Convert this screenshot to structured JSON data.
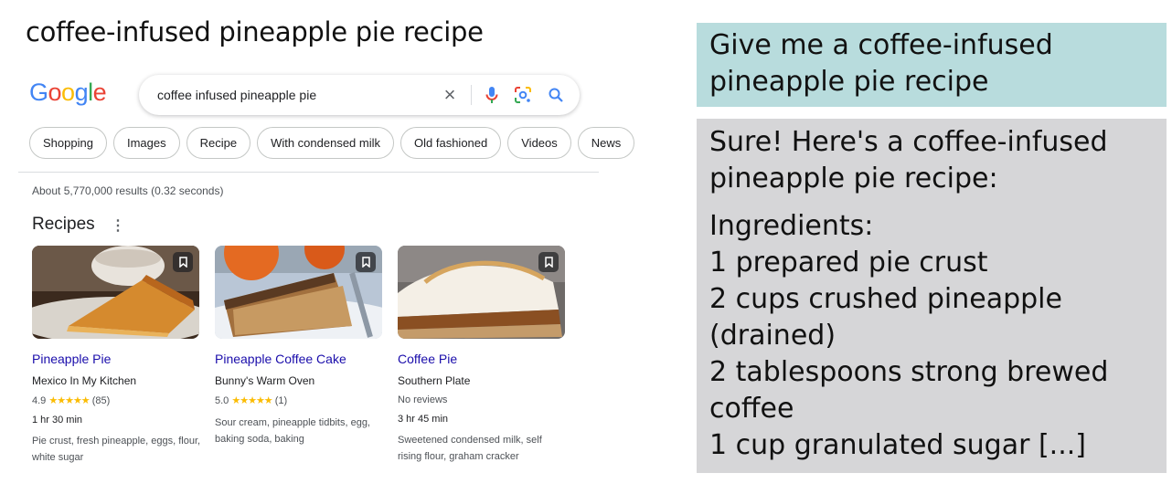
{
  "slide_title": "coffee-infused pineapple pie recipe",
  "google": {
    "logo_letters": [
      {
        "ch": "G",
        "color": "#4285F4"
      },
      {
        "ch": "o",
        "color": "#EA4335"
      },
      {
        "ch": "o",
        "color": "#FBBC05"
      },
      {
        "ch": "g",
        "color": "#4285F4"
      },
      {
        "ch": "l",
        "color": "#34A853"
      },
      {
        "ch": "e",
        "color": "#EA4335"
      }
    ],
    "search_query": "coffee infused pineapple pie",
    "chips": [
      "Shopping",
      "Images",
      "Recipe",
      "With condensed milk",
      "Old fashioned",
      "Videos",
      "News"
    ],
    "result_stats": "About 5,770,000 results (0.32 seconds)",
    "recipes_heading": "Recipes",
    "recipes": [
      {
        "title": "Pineapple Pie",
        "source": "Mexico In My Kitchen",
        "rating": "4.9",
        "stars": "★★★★★",
        "reviews": "(85)",
        "time": "1 hr 30 min",
        "ingredients": "Pie crust, fresh pineapple, eggs, flour, white sugar"
      },
      {
        "title": "Pineapple Coffee Cake",
        "source": "Bunny's Warm Oven",
        "rating": "5.0",
        "stars": "★★★★★",
        "reviews": "(1)",
        "time": "",
        "ingredients": "Sour cream, pineapple tidbits, egg, baking soda, baking"
      },
      {
        "title": "Coffee Pie",
        "source": "Southern Plate",
        "no_reviews": "No reviews",
        "time": "3 hr 45 min",
        "ingredients": "Sweetened condensed milk, self rising flour, graham cracker"
      }
    ]
  },
  "chat": {
    "prompt": "Give me a coffee-infused pineapple pie recipe",
    "response_intro": "Sure! Here's a coffee-infused pineapple pie recipe:",
    "ingredients_heading": "Ingredients:",
    "ingredients": [
      "1 prepared pie crust",
      "2 cups crushed pineapple (drained)",
      "2 tablespoons strong brewed coffee",
      "1 cup granulated sugar [...]"
    ]
  },
  "colors": {
    "link_blue": "#1a0dab",
    "star_yellow": "#fbbc04",
    "prompt_bg": "#b8dcdd",
    "answer_bg": "#d6d6d8"
  }
}
